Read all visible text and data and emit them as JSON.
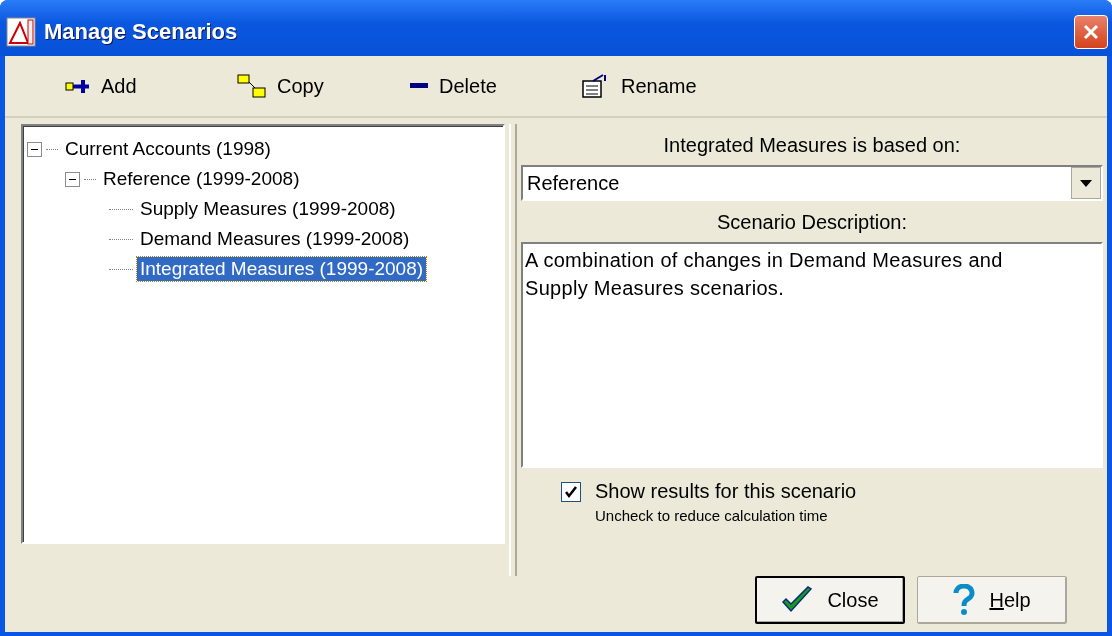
{
  "window": {
    "title": "Manage Scenarios"
  },
  "toolbar": [
    {
      "kind": "add",
      "label": "Add"
    },
    {
      "kind": "copy",
      "label": "Copy"
    },
    {
      "kind": "delete",
      "label": "Delete"
    },
    {
      "kind": "rename",
      "label": "Rename"
    }
  ],
  "tree": [
    {
      "label": "Current Accounts (1998)",
      "expanded": true,
      "selected": false,
      "children": [
        {
          "label": "Reference (1999-2008)",
          "expanded": true,
          "selected": false,
          "children": [
            {
              "label": "Supply Measures (1999-2008)",
              "selected": false
            },
            {
              "label": "Demand Measures (1999-2008)",
              "selected": false
            },
            {
              "label": "Integrated Measures (1999-2008)",
              "selected": true
            }
          ]
        }
      ]
    }
  ],
  "based_on": {
    "label": "Integrated Measures is based on:",
    "value": "Reference"
  },
  "description": {
    "label": "Scenario Description:",
    "value": "A combination of changes in Demand Measures and Supply Measures scenarios."
  },
  "show_results": {
    "label": "Show results for this scenario",
    "hint": "Uncheck to reduce calculation time",
    "checked": true
  },
  "buttons": [
    {
      "kind": "close",
      "label": "Close",
      "default": true,
      "first_letter_underlined": false
    },
    {
      "kind": "help",
      "label": "Help",
      "default": false,
      "first_letter_underlined": true
    }
  ]
}
